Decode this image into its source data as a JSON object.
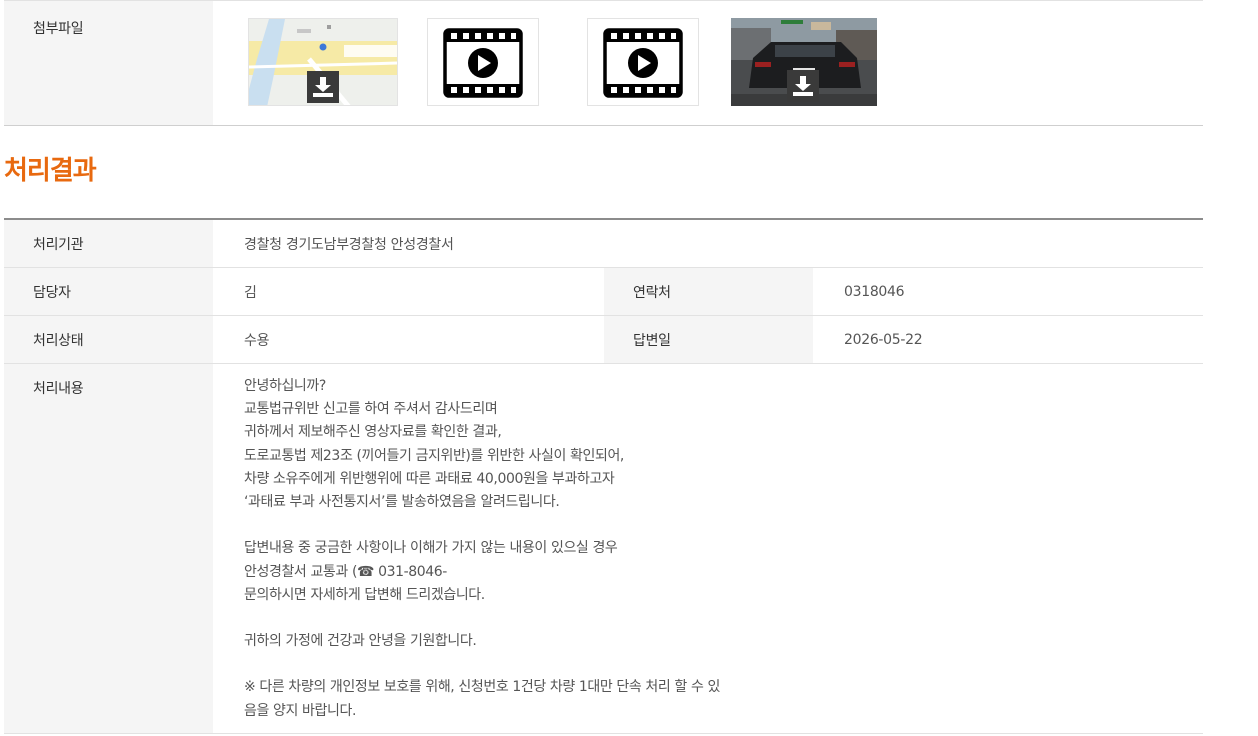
{
  "attachments": {
    "label": "첨부파일"
  },
  "section_title": "처리결과",
  "result": {
    "agency_label": "처리기관",
    "agency_value": "경찰청 경기도남부경찰청 안성경찰서",
    "manager_label": "담당자",
    "manager_value": "김",
    "contact_label": "연락처",
    "contact_value": "0318046",
    "status_label": "처리상태",
    "status_value": "수용",
    "reply_date_label": "답변일",
    "reply_date_value": "2026-05-22",
    "content_label": "처리내용",
    "content_lines": [
      "안녕하십니까?",
      "교통법규위반 신고를 하여 주셔서 감사드리며",
      "귀하께서 제보해주신 영상자료를 확인한 결과,",
      "도로교통법 제23조 (끼어들기 금지위반)를 위반한 사실이 확인되어,",
      "차량 소유주에게 위반행위에 따른 과태료 40,000원을 부과하고자",
      "‘과태료 부과 사전통지서’를 발송하였음을 알려드립니다.",
      "",
      "답변내용 중 궁금한 사항이나 이해가 가지 않는 내용이 있으실 경우",
      "안성경찰서 교통과 (☎ 031-8046-",
      "문의하시면 자세하게 답변해 드리겠습니다.",
      "",
      "귀하의 가정에 건강과 안녕을 기원합니다.",
      "",
      "※ 다른 차량의 개인정보 보호를 위해, 신청번호 1건당 차량 1대만 단속 처리 할 수 있",
      "음을 양지 바랍니다."
    ]
  }
}
